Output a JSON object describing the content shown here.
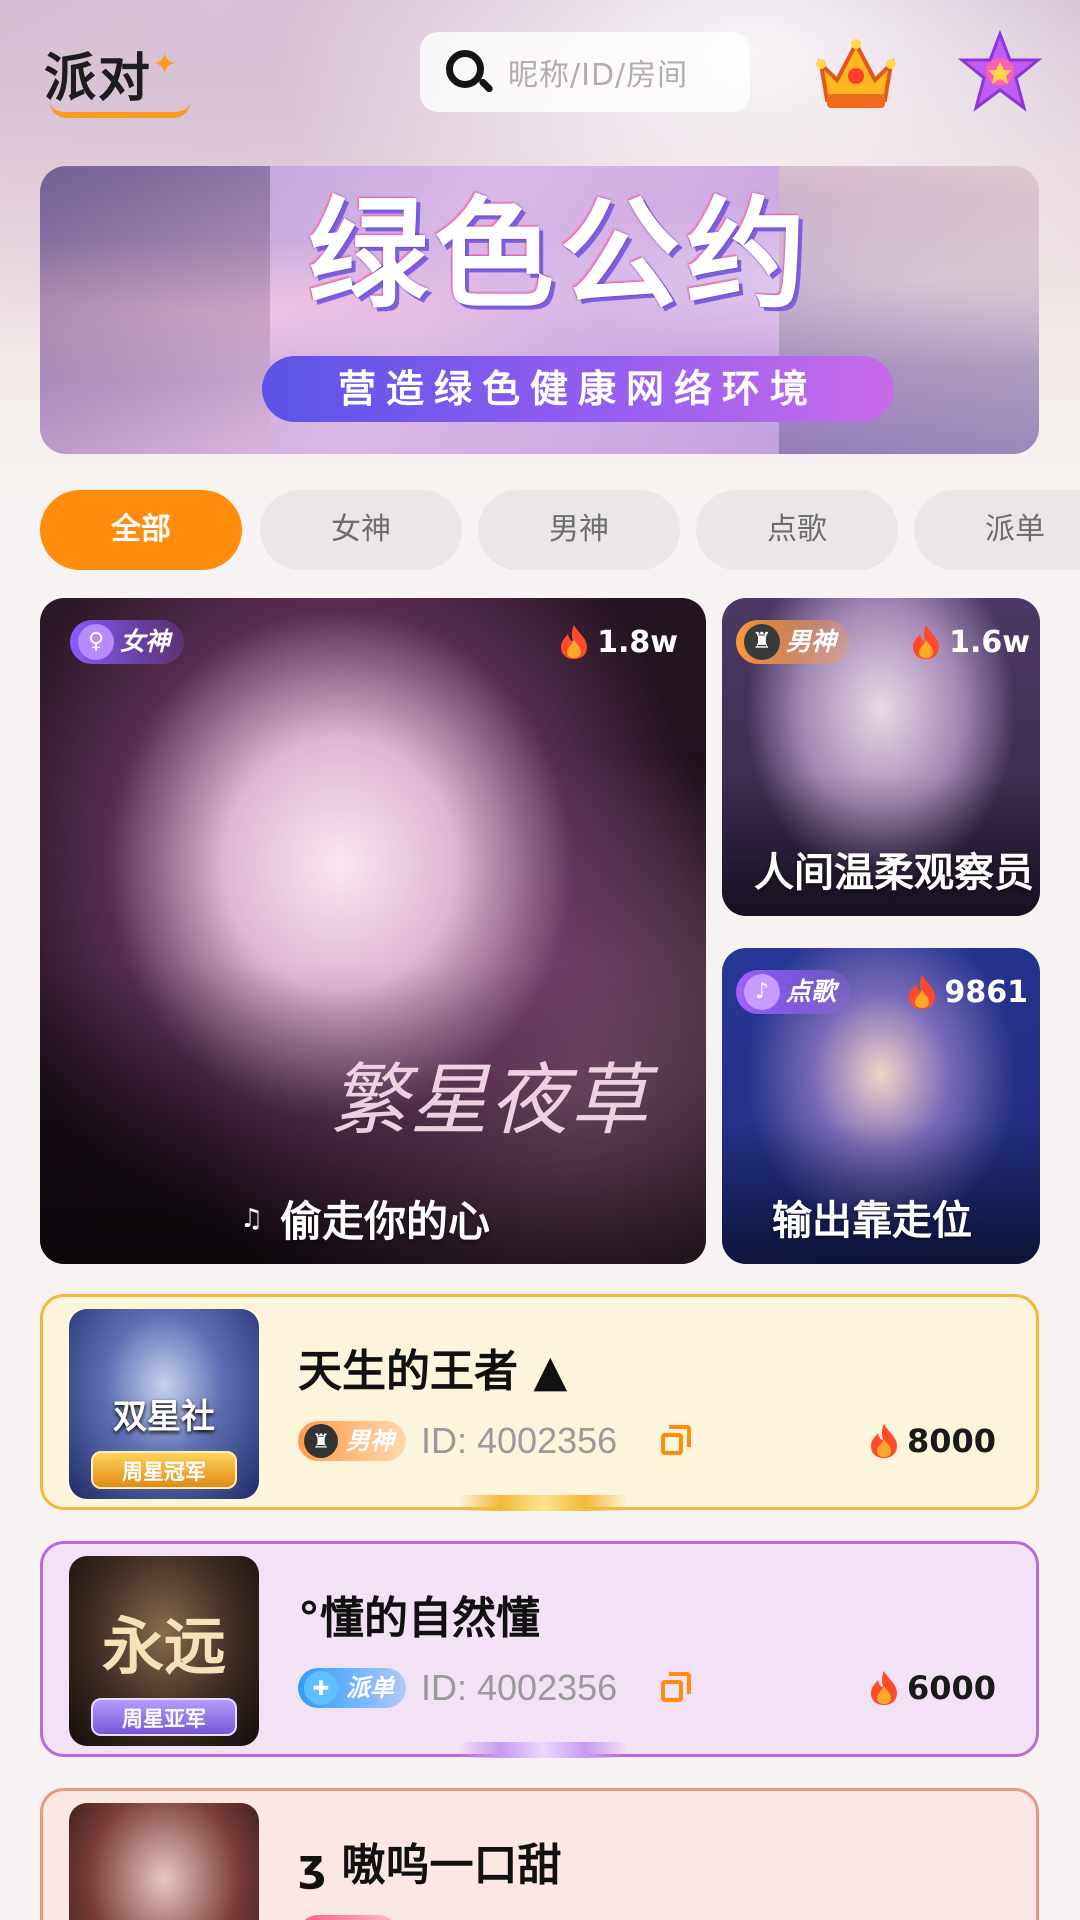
{
  "header": {
    "logo_text": "派对",
    "search_placeholder": "昵称/ID/房间",
    "icons": [
      "search-icon",
      "crown-icon",
      "star-badge-icon"
    ]
  },
  "banner": {
    "title": "绿色公约",
    "subtitle": "营造绿色健康网络环境"
  },
  "tabs": [
    {
      "label": "全部",
      "active": true
    },
    {
      "label": "女神",
      "active": false
    },
    {
      "label": "男神",
      "active": false
    },
    {
      "label": "点歌",
      "active": false
    },
    {
      "label": "派单",
      "active": false
    }
  ],
  "featured": [
    {
      "category": "女神",
      "heat": "1.8w",
      "art_text": "繁星夜草",
      "name": "偷走你的心"
    },
    {
      "category": "男神",
      "heat": "1.6w",
      "name": "人间温柔观察员"
    },
    {
      "category": "点歌",
      "heat": "9861",
      "name": "输出靠走位"
    }
  ],
  "rooms": [
    {
      "name": "天生的王者 ▲",
      "tag": "男神",
      "id_text": "ID: 4002356",
      "heat": "8000",
      "rank": "周星冠军",
      "thumb_text": "双星社"
    },
    {
      "name": "°懂的自然懂",
      "tag": "派单",
      "id_text": "ID: 4002356",
      "heat": "6000",
      "rank": "周星亚军",
      "thumb_text": "永远"
    },
    {
      "name": "ʒ 嗷呜一口甜"
    }
  ],
  "colors": {
    "accent": "#ff8c0a",
    "row1_border": "#f2b93b",
    "row2_border": "#b56cd8",
    "row3_border": "#e69a86"
  }
}
